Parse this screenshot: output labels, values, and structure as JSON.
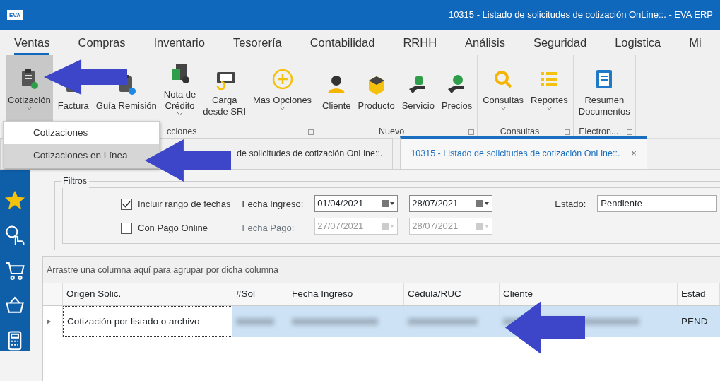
{
  "window": {
    "logo": "EVA",
    "title": "10315 - Listado de solicitudes de cotización OnLine::. - EVA ERP"
  },
  "menu_tabs": [
    {
      "label": "Ventas",
      "selected": true
    },
    {
      "label": "Compras",
      "selected": false
    },
    {
      "label": "Inventario",
      "selected": false
    },
    {
      "label": "Tesorería",
      "selected": false
    },
    {
      "label": "Contabilidad",
      "selected": false
    },
    {
      "label": "RRHH",
      "selected": false
    },
    {
      "label": "Análisis",
      "selected": false
    },
    {
      "label": "Seguridad",
      "selected": false
    },
    {
      "label": "Logistica",
      "selected": false
    },
    {
      "label": "Mi",
      "selected": false
    }
  ],
  "ribbon_groups": [
    {
      "label": "cciones",
      "buttons": [
        {
          "kind": "quote",
          "label": "Cotización",
          "dropdown": true,
          "selected": true
        },
        {
          "kind": "invoice",
          "label": "Factura",
          "dropdown": false,
          "selected": false
        },
        {
          "kind": "guide",
          "label": "Guía Remisión",
          "dropdown": false,
          "selected": false
        },
        {
          "kind": "credit",
          "label": "Nota de\nCrédito",
          "dropdown": true,
          "selected": false
        },
        {
          "kind": "sri",
          "label": "Carga\ndesde SRI",
          "dropdown": false,
          "selected": false
        },
        {
          "kind": "plus",
          "label": "Mas Opciones",
          "dropdown": true,
          "selected": false
        }
      ]
    },
    {
      "label": "Nuevo",
      "buttons": [
        {
          "kind": "person",
          "label": "Cliente",
          "dropdown": false,
          "selected": false
        },
        {
          "kind": "box",
          "label": "Producto",
          "dropdown": false,
          "selected": false
        },
        {
          "kind": "service",
          "label": "Servicio",
          "dropdown": false,
          "selected": false
        },
        {
          "kind": "price",
          "label": "Precios",
          "dropdown": false,
          "selected": false
        }
      ]
    },
    {
      "label": "Consultas",
      "buttons": [
        {
          "kind": "search",
          "label": "Consultas",
          "dropdown": true,
          "selected": false
        },
        {
          "kind": "list",
          "label": "Reportes",
          "dropdown": true,
          "selected": false
        }
      ]
    },
    {
      "label": "Electron...",
      "buttons": [
        {
          "kind": "doc",
          "label": "Resumen\nDocumentos",
          "dropdown": false,
          "selected": false
        }
      ]
    }
  ],
  "dropdown_menu": [
    {
      "label": "Cotizaciones",
      "selected": false
    },
    {
      "label": "Cotizaciones en Línea",
      "selected": true
    }
  ],
  "doc_tabs": [
    {
      "label": "de solicitudes de cotización OnLine::.",
      "selected": false
    },
    {
      "label": "10315 - Listado de solicitudes de cotización OnLine::.",
      "selected": true,
      "close": "×"
    }
  ],
  "sidebar": [
    {
      "kind": "star"
    },
    {
      "kind": "coin"
    },
    {
      "kind": "cart"
    },
    {
      "kind": "basket"
    },
    {
      "kind": "calculator"
    }
  ],
  "filters": {
    "title": "Filtros",
    "checkboxes": [
      {
        "label": "Incluir rango de fechas",
        "checked": true
      },
      {
        "label": "Con Pago Online",
        "checked": false
      }
    ],
    "date_rows": [
      {
        "label": "Fecha Ingreso:",
        "from": "01/04/2021",
        "to": "28/07/2021",
        "disabled": false
      },
      {
        "label": "Fecha Pago:",
        "from": "27/07/2021",
        "to": "28/07/2021",
        "disabled": true
      }
    ],
    "estado_label": "Estado:",
    "estado_value": "Pendiente"
  },
  "grid": {
    "group_hint": "Arrastre una columna aquí para agrupar por dicha columna",
    "columns": [
      "Origen Solic.",
      "#Sol",
      "Fecha Ingreso",
      "Cédula/RUC",
      "Cliente",
      "Estad"
    ],
    "rows": [
      {
        "selected": true,
        "cells": [
          {
            "text": "Cotización por listado o archivo",
            "blurred": false
          },
          {
            "blurred": true
          },
          {
            "blurred": true
          },
          {
            "blurred": true
          },
          {
            "blurred": true
          },
          {
            "text": "PEND",
            "blurred": false
          }
        ]
      }
    ]
  }
}
